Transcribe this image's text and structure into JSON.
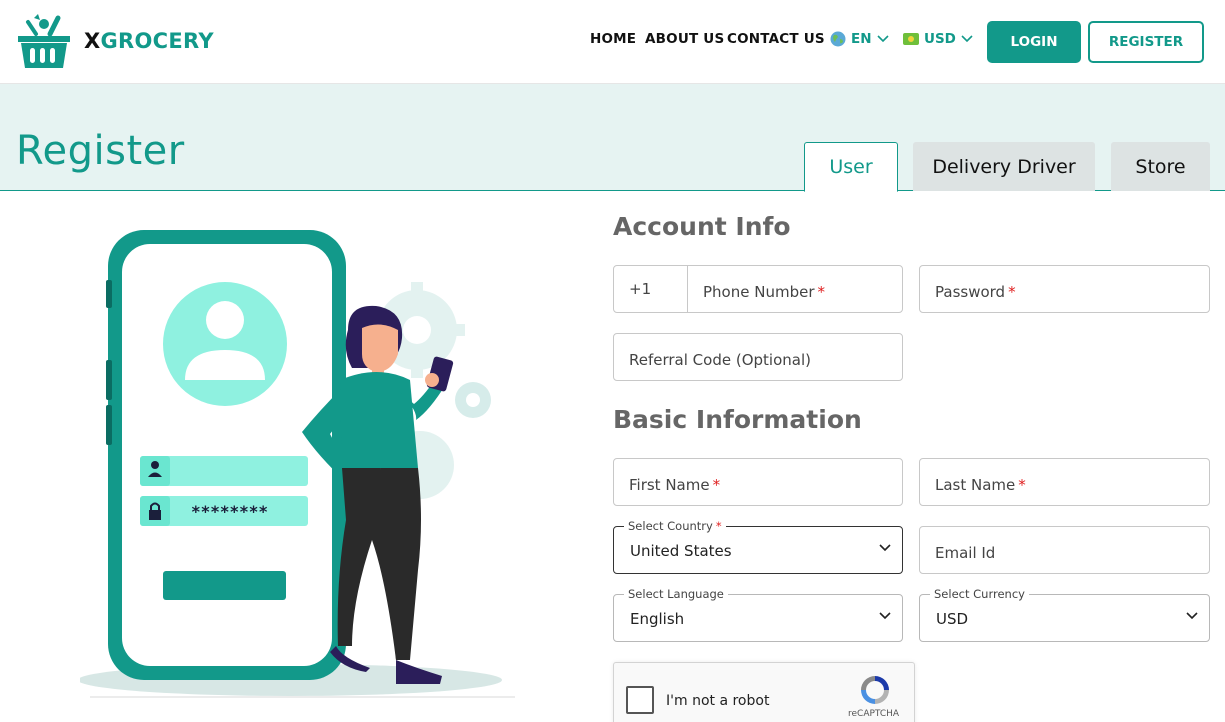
{
  "header": {
    "brand_x": "X",
    "brand_rest": "GROCERY",
    "nav": [
      "HOME",
      "ABOUT US",
      "CONTACT US"
    ],
    "language": "EN",
    "currency": "USD",
    "login_label": "LOGIN",
    "register_label": "REGISTER"
  },
  "page": {
    "title": "Register",
    "tabs": [
      {
        "label": "User",
        "active": true
      },
      {
        "label": "Delivery Driver",
        "active": false
      },
      {
        "label": "Store",
        "active": false
      }
    ]
  },
  "illustration": {
    "password_mask": "********"
  },
  "account_info": {
    "title": "Account Info",
    "phone_prefix": "+1",
    "phone_placeholder": "Phone Number",
    "password_placeholder": "Password",
    "referral_placeholder": "Referral Code (Optional)"
  },
  "basic_info": {
    "title": "Basic Information",
    "first_name_placeholder": "First Name",
    "last_name_placeholder": "Last Name",
    "country_label": "Select Country",
    "country_value": "United States",
    "email_placeholder": "Email Id",
    "language_label": "Select Language",
    "language_value": "English",
    "currency_label": "Select Currency",
    "currency_value": "USD"
  },
  "recaptcha": {
    "text": "I'm not a robot",
    "brand": "reCAPTCHA"
  },
  "colors": {
    "primary": "#12998a",
    "banner_bg": "#e6f3f2",
    "required": "#e02020"
  }
}
